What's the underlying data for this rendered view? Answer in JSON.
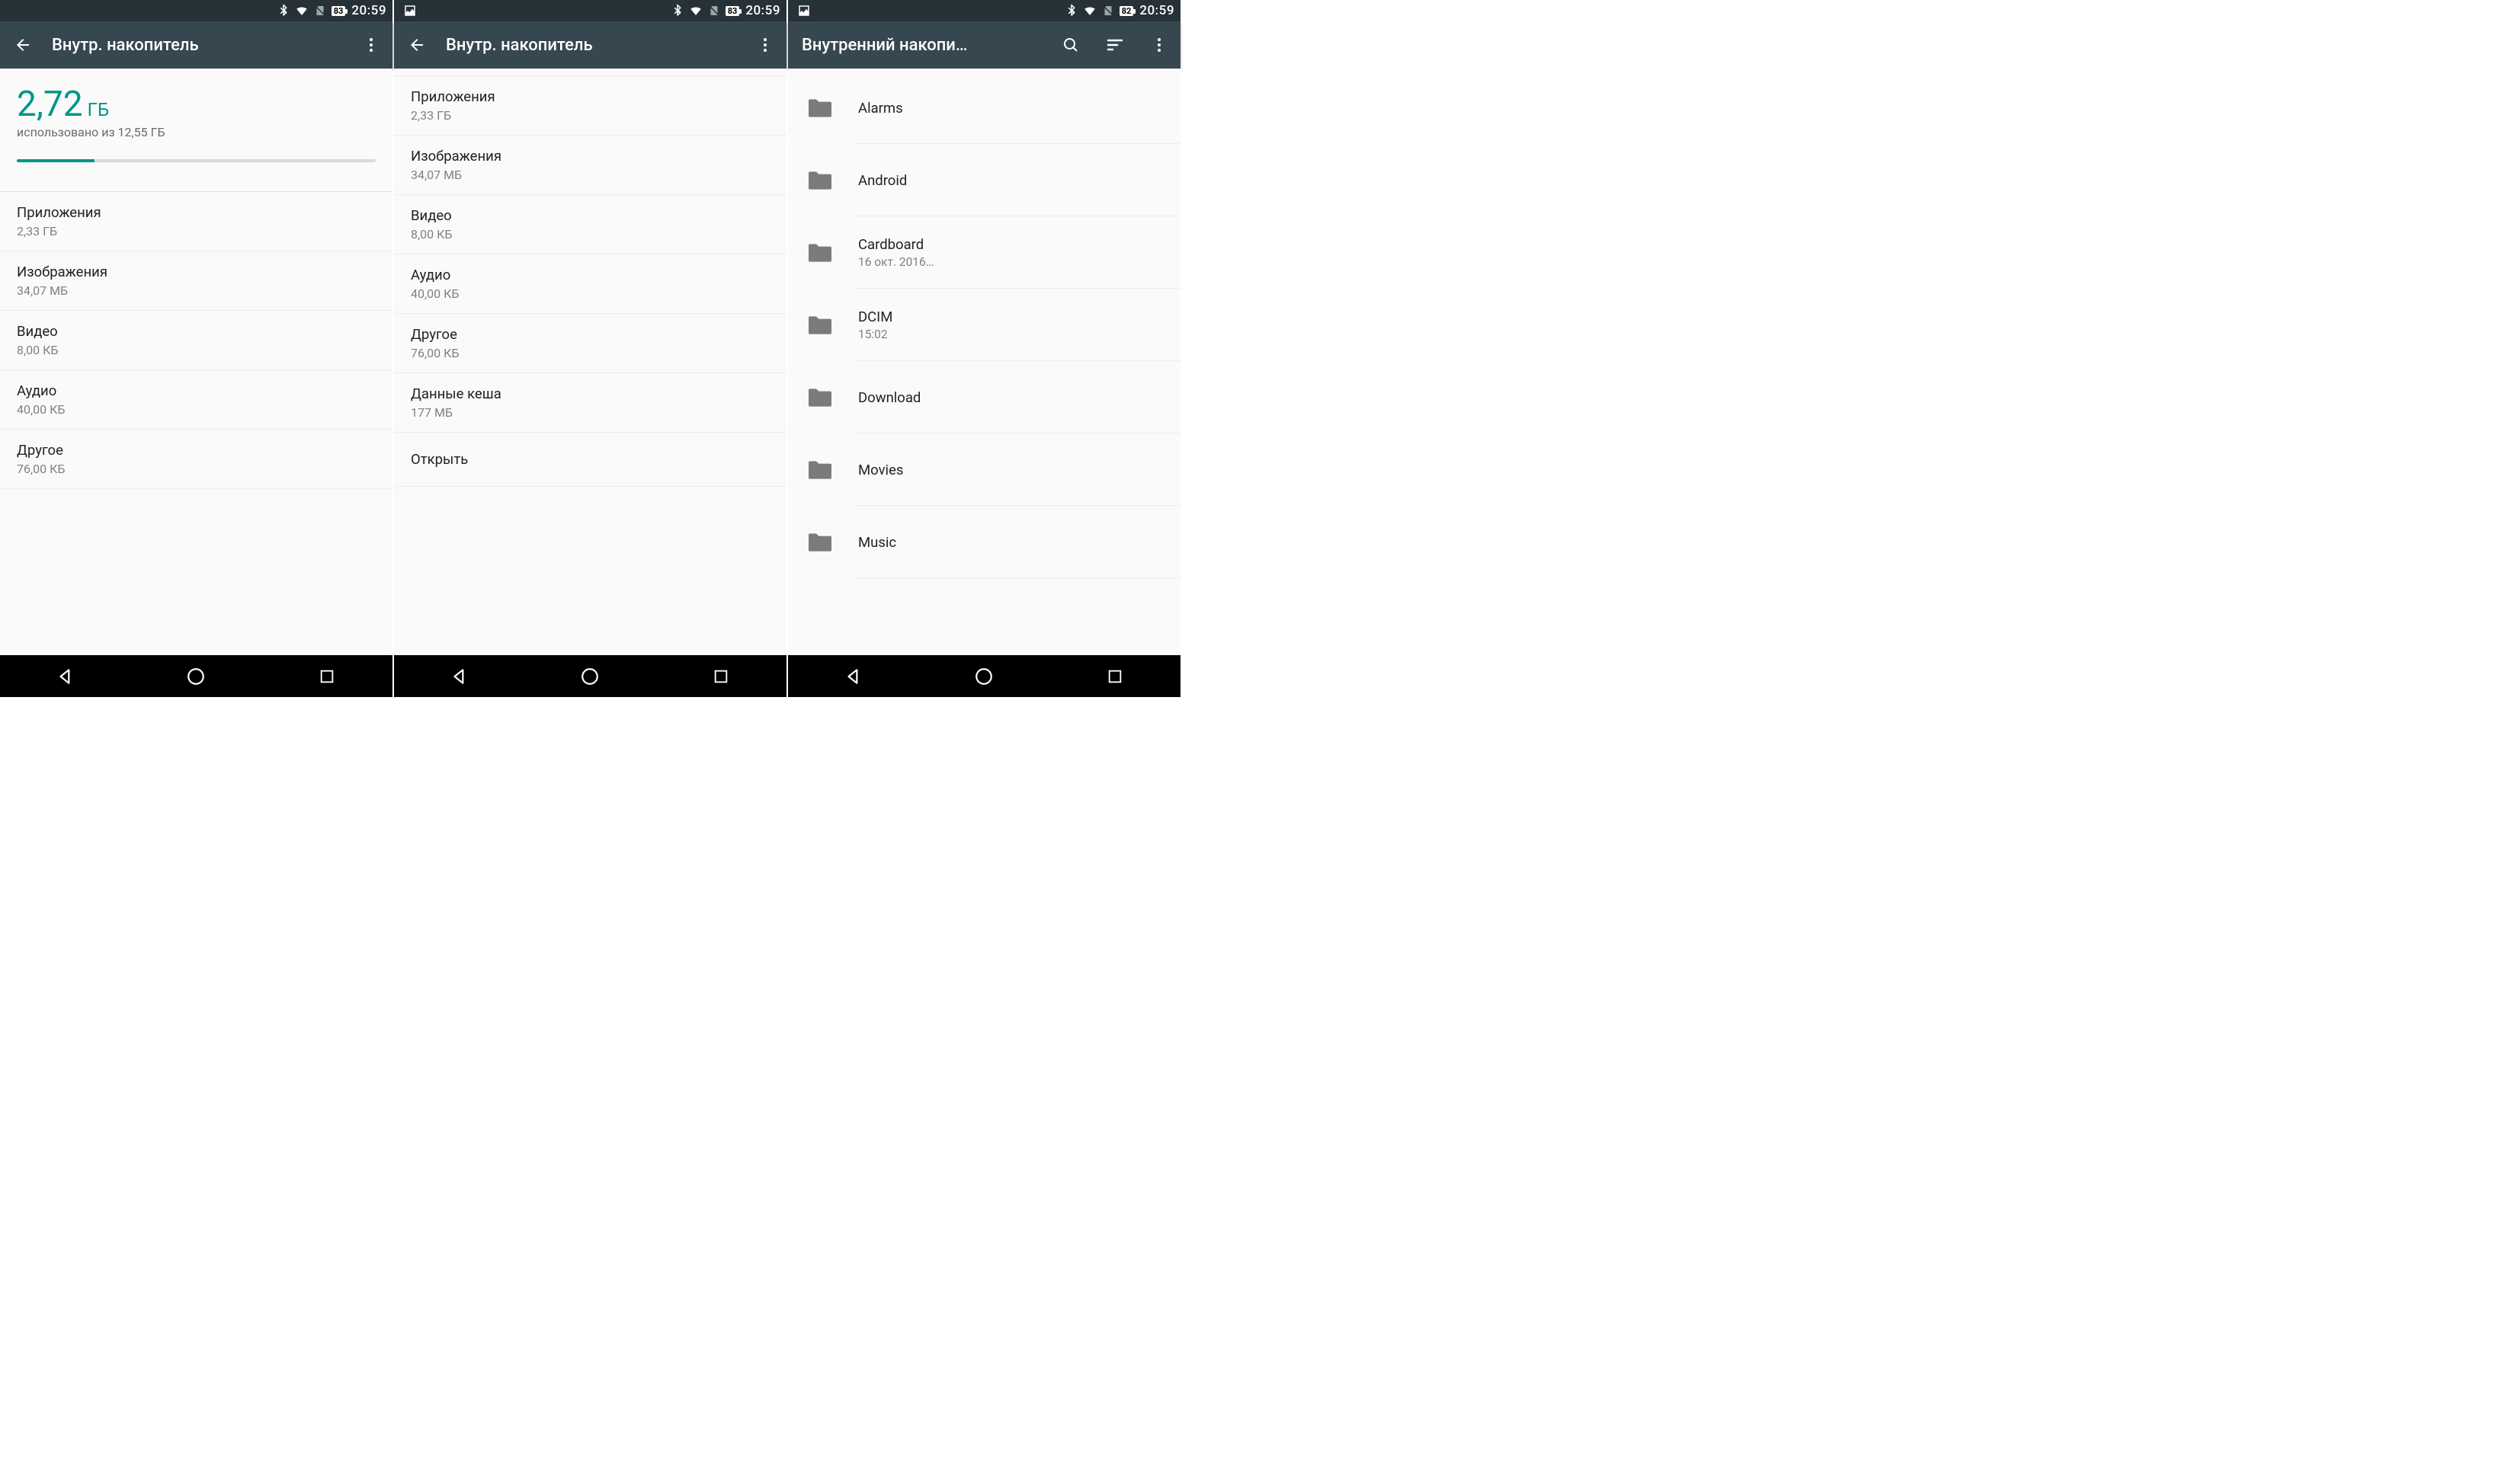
{
  "statusbar": {
    "time": "20:59",
    "battery": [
      "83",
      "83",
      "82"
    ]
  },
  "screen1": {
    "title": "Внутр. накопитель",
    "used_value": "2,72",
    "used_unit": "ГБ",
    "used_subtitle": "использовано из 12,55 ГБ",
    "progress_pct": 21.7,
    "items": [
      {
        "label": "Приложения",
        "value": "2,33 ГБ"
      },
      {
        "label": "Изображения",
        "value": "34,07 МБ"
      },
      {
        "label": "Видео",
        "value": "8,00 КБ"
      },
      {
        "label": "Аудио",
        "value": "40,00 КБ"
      },
      {
        "label": "Другое",
        "value": "76,00 КБ"
      }
    ]
  },
  "screen2": {
    "title": "Внутр. накопитель",
    "items": [
      {
        "label": "Приложения",
        "value": "2,33 ГБ"
      },
      {
        "label": "Изображения",
        "value": "34,07 МБ"
      },
      {
        "label": "Видео",
        "value": "8,00 КБ"
      },
      {
        "label": "Аудио",
        "value": "40,00 КБ"
      },
      {
        "label": "Другое",
        "value": "76,00 КБ"
      },
      {
        "label": "Данные кеша",
        "value": "177 МБ"
      }
    ],
    "open_label": "Открыть"
  },
  "screen3": {
    "title": "Внутренний накопи…",
    "folders": [
      {
        "name": "Alarms",
        "sub": ""
      },
      {
        "name": "Android",
        "sub": ""
      },
      {
        "name": "Cardboard",
        "sub": "16 окт. 2016…"
      },
      {
        "name": "DCIM",
        "sub": "15:02"
      },
      {
        "name": "Download",
        "sub": ""
      },
      {
        "name": "Movies",
        "sub": ""
      },
      {
        "name": "Music",
        "sub": ""
      }
    ]
  }
}
